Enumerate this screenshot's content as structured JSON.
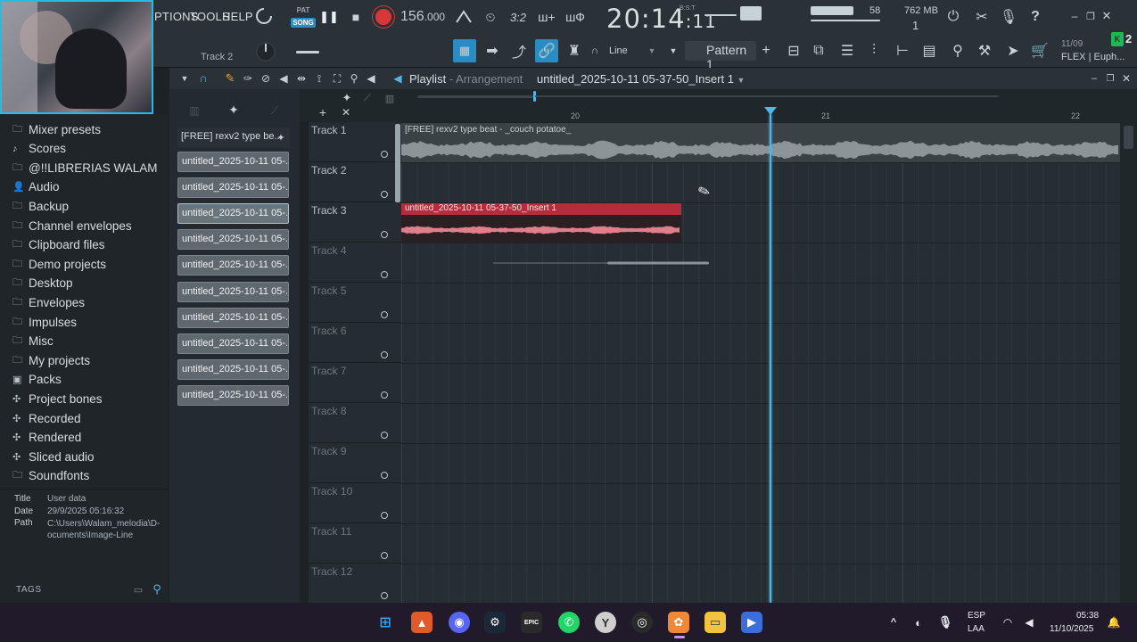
{
  "menu": {
    "options": "PTIONS",
    "tools": "TOOLS",
    "help": "HELP"
  },
  "transport": {
    "mode_pat": "PAT",
    "mode_song": "SONG",
    "tempo_int": "156",
    "tempo_dec": ".000",
    "clock_main": "20:14",
    "clock_sec": ":11",
    "clock_suffix": "B:S:T"
  },
  "stats": {
    "cpu": "58",
    "memory": "762 MB",
    "polyphony": "1"
  },
  "toolbar": {
    "current_track": "Track 2",
    "snap_label": "Line",
    "pattern_label": "Pattern 1",
    "plugin_date": "11/09",
    "plugin_name": "FLEX | Euph...",
    "badge_count": "2"
  },
  "browser": {
    "items": [
      {
        "label": "Mixer presets",
        "icon": "folder-icon"
      },
      {
        "label": "Scores",
        "icon": "note-icon"
      },
      {
        "label": "@!!LIBRERIAS WALAM",
        "icon": "folder-icon"
      },
      {
        "label": "Audio",
        "icon": "user-icon"
      },
      {
        "label": "Backup",
        "icon": "folder-icon"
      },
      {
        "label": "Channel envelopes",
        "icon": "folder-icon"
      },
      {
        "label": "Clipboard files",
        "icon": "folder-icon"
      },
      {
        "label": "Demo projects",
        "icon": "folder-icon"
      },
      {
        "label": "Desktop",
        "icon": "folder-icon"
      },
      {
        "label": "Envelopes",
        "icon": "folder-icon"
      },
      {
        "label": "Impulses",
        "icon": "folder-icon"
      },
      {
        "label": "Misc",
        "icon": "folder-icon"
      },
      {
        "label": "My projects",
        "icon": "folder-icon"
      },
      {
        "label": "Packs",
        "icon": "packs-icon"
      },
      {
        "label": "Project bones",
        "icon": "plugin-icon"
      },
      {
        "label": "Recorded",
        "icon": "plugin-icon"
      },
      {
        "label": "Rendered",
        "icon": "plugin-icon"
      },
      {
        "label": "Sliced audio",
        "icon": "plugin-icon"
      },
      {
        "label": "Soundfonts",
        "icon": "folder-icon"
      }
    ],
    "info": {
      "title_key": "Title",
      "title_val": "User data",
      "date_key": "Date",
      "date_val": "29/9/2025 05:16:32",
      "path_key": "Path",
      "path_val": "C:\\Users\\Walam_melodia\\D-ocuments\\Image-Line"
    },
    "tags_label": "TAGS"
  },
  "picker": {
    "header": "[FREE] rexv2 type be...",
    "clips": [
      "untitled_2025-10-11 05-...",
      "untitled_2025-10-11 05-...",
      "untitled_2025-10-11 05-...",
      "untitled_2025-10-11 05-...",
      "untitled_2025-10-11 05-...",
      "untitled_2025-10-11 05-...",
      "untitled_2025-10-11 05-...",
      "untitled_2025-10-11 05-...",
      "untitled_2025-10-11 05-...",
      "untitled_2025-10-11 05-..."
    ],
    "selected_index": 2
  },
  "playlist": {
    "title": "Playlist",
    "subtitle": "Arrangement",
    "pattern_name": "untitled_2025-10-11 05-37-50_Insert 1",
    "ruler": [
      "20",
      "21",
      "22"
    ],
    "tracks": [
      "Track 1",
      "Track 2",
      "Track 3",
      "Track 4",
      "Track 5",
      "Track 6",
      "Track 7",
      "Track 8",
      "Track 9",
      "Track 10",
      "Track 11",
      "Track 12"
    ],
    "clip_track1": "[FREE] rexv2 type beat - _couch potatoe_",
    "clip_track3": "untitled_2025-10-11 05-37-50_Insert 1",
    "accent_color": "#4fb6e6",
    "clip3_color": "#b52d3c"
  },
  "taskbar": {
    "lang_line1": "ESP",
    "lang_line2": "LAA",
    "time": "05:38",
    "date": "11/10/2025"
  }
}
